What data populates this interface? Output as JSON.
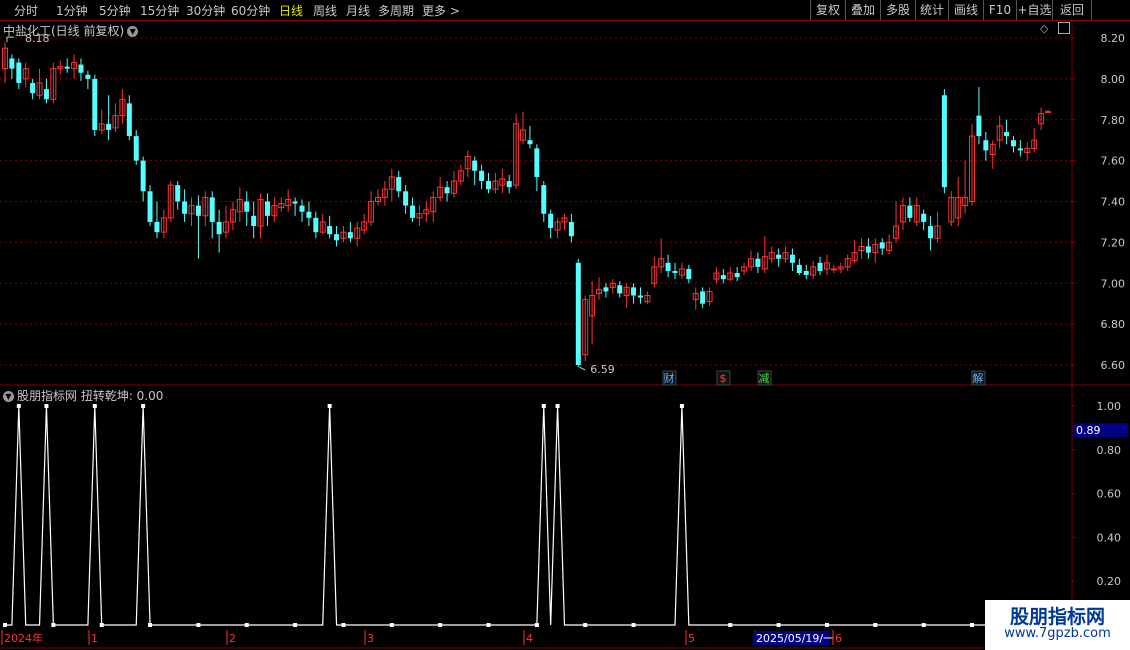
{
  "toolbar": {
    "left_items": [
      "分时",
      "1分钟",
      "5分钟",
      "15分钟",
      "30分钟",
      "60分钟",
      "日线",
      "周线",
      "月线",
      "多周期",
      "更多 >"
    ],
    "active": "日线",
    "right_items": [
      "复权",
      "叠加",
      "多股",
      "统计",
      "画线",
      "F10",
      "+自选",
      "返回"
    ]
  },
  "main": {
    "title": "中盐化工(日线 前复权)",
    "icons": [
      "chevron-down-icon",
      "diamond-icon",
      "window-icon"
    ],
    "y_ticks": [
      "8.20",
      "8.00",
      "7.80",
      "7.60",
      "7.40",
      "7.20",
      "7.00",
      "6.80",
      "6.60"
    ],
    "high_label": "8.18",
    "low_label": "6.59",
    "events": [
      {
        "text": "财",
        "color": "#5fb3ff"
      },
      {
        "text": "$",
        "color": "#ff4040"
      },
      {
        "text": "减",
        "color": "#40e040"
      },
      {
        "text": "解",
        "color": "#5fb3ff"
      }
    ]
  },
  "indicator": {
    "title": "股朋指标网 扭转乾坤: 0.00",
    "y_ticks": [
      "1.00",
      "0.80",
      "0.60",
      "0.40",
      "0.20"
    ],
    "current_value": "0.89"
  },
  "xaxis": {
    "labels": [
      "2024年",
      "1",
      "2",
      "3",
      "4",
      "5",
      "2025/05/19/一",
      "6"
    ]
  },
  "watermark": {
    "line1": "股朋指标网",
    "line2": "www.7gpzb.com"
  },
  "colors": {
    "up": "#ff3232",
    "down": "#54ffff",
    "grid": "#800000",
    "line": "#ffffff"
  },
  "chart_data": {
    "type": "candlestick",
    "ylim": [
      6.55,
      8.24
    ],
    "candles": [
      [
        8.05,
        8.15,
        8.18,
        7.98
      ],
      [
        8.1,
        8.05,
        8.12,
        8.0
      ],
      [
        8.08,
        7.98,
        8.1,
        7.95
      ],
      [
        8.0,
        8.05,
        8.08,
        7.96
      ],
      [
        7.98,
        7.93,
        8.0,
        7.9
      ],
      [
        7.92,
        7.98,
        8.05,
        7.9
      ],
      [
        7.95,
        7.9,
        8.0,
        7.88
      ],
      [
        7.9,
        8.05,
        8.08,
        7.88
      ],
      [
        8.05,
        8.06,
        8.09,
        8.02
      ],
      [
        8.06,
        8.05,
        8.1,
        8.03
      ],
      [
        8.05,
        8.08,
        8.12,
        8.0
      ],
      [
        8.07,
        8.03,
        8.1,
        7.99
      ],
      [
        8.02,
        8.0,
        8.04,
        7.95
      ],
      [
        8.0,
        7.75,
        8.02,
        7.72
      ],
      [
        7.75,
        7.78,
        7.85,
        7.73
      ],
      [
        7.78,
        7.75,
        7.92,
        7.7
      ],
      [
        7.76,
        7.82,
        7.88,
        7.74
      ],
      [
        7.82,
        7.9,
        7.95,
        7.78
      ],
      [
        7.88,
        7.72,
        7.92,
        7.7
      ],
      [
        7.72,
        7.6,
        7.75,
        7.58
      ],
      [
        7.6,
        7.45,
        7.62,
        7.4
      ],
      [
        7.45,
        7.3,
        7.48,
        7.28
      ],
      [
        7.3,
        7.25,
        7.4,
        7.22
      ],
      [
        7.25,
        7.32,
        7.36,
        7.22
      ],
      [
        7.32,
        7.48,
        7.5,
        7.3
      ],
      [
        7.48,
        7.4,
        7.5,
        7.36
      ],
      [
        7.4,
        7.34,
        7.46,
        7.3
      ],
      [
        7.34,
        7.38,
        7.42,
        7.28
      ],
      [
        7.38,
        7.33,
        7.43,
        7.12
      ],
      [
        7.33,
        7.42,
        7.45,
        7.28
      ],
      [
        7.42,
        7.3,
        7.45,
        7.22
      ],
      [
        7.3,
        7.24,
        7.36,
        7.15
      ],
      [
        7.25,
        7.3,
        7.38,
        7.22
      ],
      [
        7.3,
        7.36,
        7.4,
        7.26
      ],
      [
        7.35,
        7.41,
        7.47,
        7.3
      ],
      [
        7.4,
        7.35,
        7.45,
        7.28
      ],
      [
        7.33,
        7.28,
        7.4,
        7.22
      ],
      [
        7.28,
        7.41,
        7.44,
        7.22
      ],
      [
        7.4,
        7.33,
        7.44,
        7.28
      ],
      [
        7.33,
        7.38,
        7.42,
        7.3
      ],
      [
        7.37,
        7.39,
        7.42,
        7.35
      ],
      [
        7.38,
        7.41,
        7.46,
        7.35
      ],
      [
        7.4,
        7.39,
        7.42,
        7.33
      ],
      [
        7.38,
        7.35,
        7.41,
        7.3
      ],
      [
        7.35,
        7.32,
        7.4,
        7.28
      ],
      [
        7.32,
        7.25,
        7.35,
        7.22
      ],
      [
        7.25,
        7.3,
        7.34,
        7.24
      ],
      [
        7.28,
        7.24,
        7.33,
        7.22
      ],
      [
        7.24,
        7.21,
        7.28,
        7.18
      ],
      [
        7.22,
        7.25,
        7.28,
        7.2
      ],
      [
        7.25,
        7.22,
        7.3,
        7.2
      ],
      [
        7.22,
        7.27,
        7.3,
        7.18
      ],
      [
        7.26,
        7.3,
        7.34,
        7.24
      ],
      [
        7.3,
        7.4,
        7.45,
        7.28
      ],
      [
        7.4,
        7.42,
        7.46,
        7.38
      ],
      [
        7.42,
        7.46,
        7.5,
        7.38
      ],
      [
        7.46,
        7.52,
        7.56,
        7.4
      ],
      [
        7.52,
        7.45,
        7.55,
        7.42
      ],
      [
        7.45,
        7.38,
        7.48,
        7.34
      ],
      [
        7.38,
        7.32,
        7.42,
        7.3
      ],
      [
        7.32,
        7.34,
        7.38,
        7.28
      ],
      [
        7.34,
        7.36,
        7.4,
        7.3
      ],
      [
        7.35,
        7.42,
        7.45,
        7.3
      ],
      [
        7.42,
        7.47,
        7.52,
        7.4
      ],
      [
        7.47,
        7.44,
        7.5,
        7.4
      ],
      [
        7.44,
        7.5,
        7.55,
        7.42
      ],
      [
        7.5,
        7.55,
        7.58,
        7.48
      ],
      [
        7.56,
        7.62,
        7.65,
        7.52
      ],
      [
        7.6,
        7.55,
        7.62,
        7.48
      ],
      [
        7.55,
        7.5,
        7.58,
        7.46
      ],
      [
        7.5,
        7.46,
        7.54,
        7.44
      ],
      [
        7.46,
        7.5,
        7.54,
        7.44
      ],
      [
        7.48,
        7.51,
        7.56,
        7.44
      ],
      [
        7.5,
        7.47,
        7.53,
        7.44
      ],
      [
        7.48,
        7.78,
        7.83,
        7.46
      ],
      [
        7.7,
        7.75,
        7.84,
        7.68
      ],
      [
        7.7,
        7.68,
        7.77,
        7.66
      ],
      [
        7.66,
        7.52,
        7.68,
        7.45
      ],
      [
        7.48,
        7.34,
        7.5,
        7.3
      ],
      [
        7.34,
        7.27,
        7.36,
        7.22
      ],
      [
        7.26,
        7.3,
        7.32,
        7.22
      ],
      [
        7.3,
        7.32,
        7.34,
        7.26
      ],
      [
        7.3,
        7.23,
        7.34,
        7.2
      ],
      [
        7.1,
        6.6,
        7.12,
        6.59
      ],
      [
        6.65,
        6.92,
        6.94,
        6.62
      ],
      [
        6.84,
        6.94,
        7.01,
        6.7
      ],
      [
        6.95,
        6.97,
        7.03,
        6.92
      ],
      [
        6.98,
        6.96,
        7.0,
        6.93
      ],
      [
        6.98,
        7.0,
        7.02,
        6.95
      ],
      [
        6.99,
        6.95,
        7.01,
        6.93
      ],
      [
        6.94,
        6.98,
        7.0,
        6.88
      ],
      [
        6.98,
        6.94,
        7.0,
        6.9
      ],
      [
        6.94,
        6.93,
        6.98,
        6.9
      ],
      [
        6.91,
        6.94,
        6.96,
        6.9
      ],
      [
        7.0,
        7.08,
        7.13,
        6.98
      ],
      [
        7.08,
        7.12,
        7.22,
        7.05
      ],
      [
        7.1,
        7.06,
        7.14,
        7.03
      ],
      [
        7.06,
        7.05,
        7.1,
        7.02
      ],
      [
        7.04,
        7.07,
        7.1,
        7.02
      ],
      [
        7.07,
        7.02,
        7.09,
        7.0
      ],
      [
        6.92,
        6.95,
        6.98,
        6.87
      ],
      [
        6.96,
        6.9,
        6.98,
        6.88
      ],
      [
        6.91,
        6.96,
        6.98,
        6.89
      ],
      [
        7.02,
        7.05,
        7.08,
        7.0
      ],
      [
        7.04,
        7.02,
        7.07,
        7.0
      ],
      [
        7.02,
        7.05,
        7.08,
        7.01
      ],
      [
        7.05,
        7.03,
        7.08,
        7.01
      ],
      [
        7.06,
        7.08,
        7.1,
        7.04
      ],
      [
        7.08,
        7.12,
        7.16,
        7.06
      ],
      [
        7.12,
        7.08,
        7.15,
        7.05
      ],
      [
        7.07,
        7.13,
        7.23,
        7.05
      ],
      [
        7.12,
        7.15,
        7.18,
        7.1
      ],
      [
        7.14,
        7.12,
        7.17,
        7.08
      ],
      [
        7.12,
        7.15,
        7.18,
        7.1
      ],
      [
        7.14,
        7.1,
        7.17,
        7.06
      ],
      [
        7.09,
        7.05,
        7.12,
        7.04
      ],
      [
        7.06,
        7.04,
        7.09,
        7.02
      ],
      [
        7.04,
        7.08,
        7.11,
        7.02
      ],
      [
        7.1,
        7.06,
        7.13,
        7.04
      ],
      [
        7.07,
        7.1,
        7.14,
        7.04
      ],
      [
        7.07,
        7.07,
        7.09,
        7.05
      ],
      [
        7.07,
        7.08,
        7.1,
        7.05
      ],
      [
        7.08,
        7.12,
        7.14,
        7.06
      ],
      [
        7.11,
        7.15,
        7.21,
        7.1
      ],
      [
        7.16,
        7.18,
        7.22,
        7.12
      ],
      [
        7.18,
        7.15,
        7.22,
        7.12
      ],
      [
        7.15,
        7.19,
        7.22,
        7.1
      ],
      [
        7.2,
        7.17,
        7.22,
        7.14
      ],
      [
        7.16,
        7.2,
        7.24,
        7.14
      ],
      [
        7.22,
        7.28,
        7.4,
        7.2
      ],
      [
        7.3,
        7.38,
        7.42,
        7.26
      ],
      [
        7.38,
        7.32,
        7.42,
        7.3
      ],
      [
        7.3,
        7.38,
        7.42,
        7.28
      ],
      [
        7.34,
        7.3,
        7.36,
        7.26
      ],
      [
        7.28,
        7.22,
        7.33,
        7.16
      ],
      [
        7.22,
        7.28,
        7.35,
        7.2
      ],
      [
        7.92,
        7.47,
        7.95,
        7.44
      ],
      [
        7.3,
        7.42,
        7.45,
        7.28
      ],
      [
        7.32,
        7.42,
        7.52,
        7.28
      ],
      [
        7.38,
        7.42,
        7.6,
        7.34
      ],
      [
        7.4,
        7.72,
        7.78,
        7.38
      ],
      [
        7.82,
        7.72,
        7.96,
        7.68
      ],
      [
        7.7,
        7.65,
        7.74,
        7.6
      ],
      [
        7.63,
        7.68,
        7.7,
        7.56
      ],
      [
        7.7,
        7.77,
        7.82,
        7.66
      ],
      [
        7.74,
        7.72,
        7.8,
        7.68
      ],
      [
        7.7,
        7.67,
        7.72,
        7.64
      ],
      [
        7.66,
        7.65,
        7.7,
        7.62
      ],
      [
        7.64,
        7.66,
        7.69,
        7.6
      ],
      [
        7.66,
        7.7,
        7.76,
        7.64
      ],
      [
        7.78,
        7.83,
        7.86,
        7.75
      ],
      [
        7.84,
        7.84,
        7.85,
        7.84
      ]
    ],
    "indicator": {
      "ylim": [
        0,
        1.05
      ],
      "peaks": [
        2,
        6,
        13,
        20,
        47,
        78,
        80,
        98
      ]
    }
  }
}
